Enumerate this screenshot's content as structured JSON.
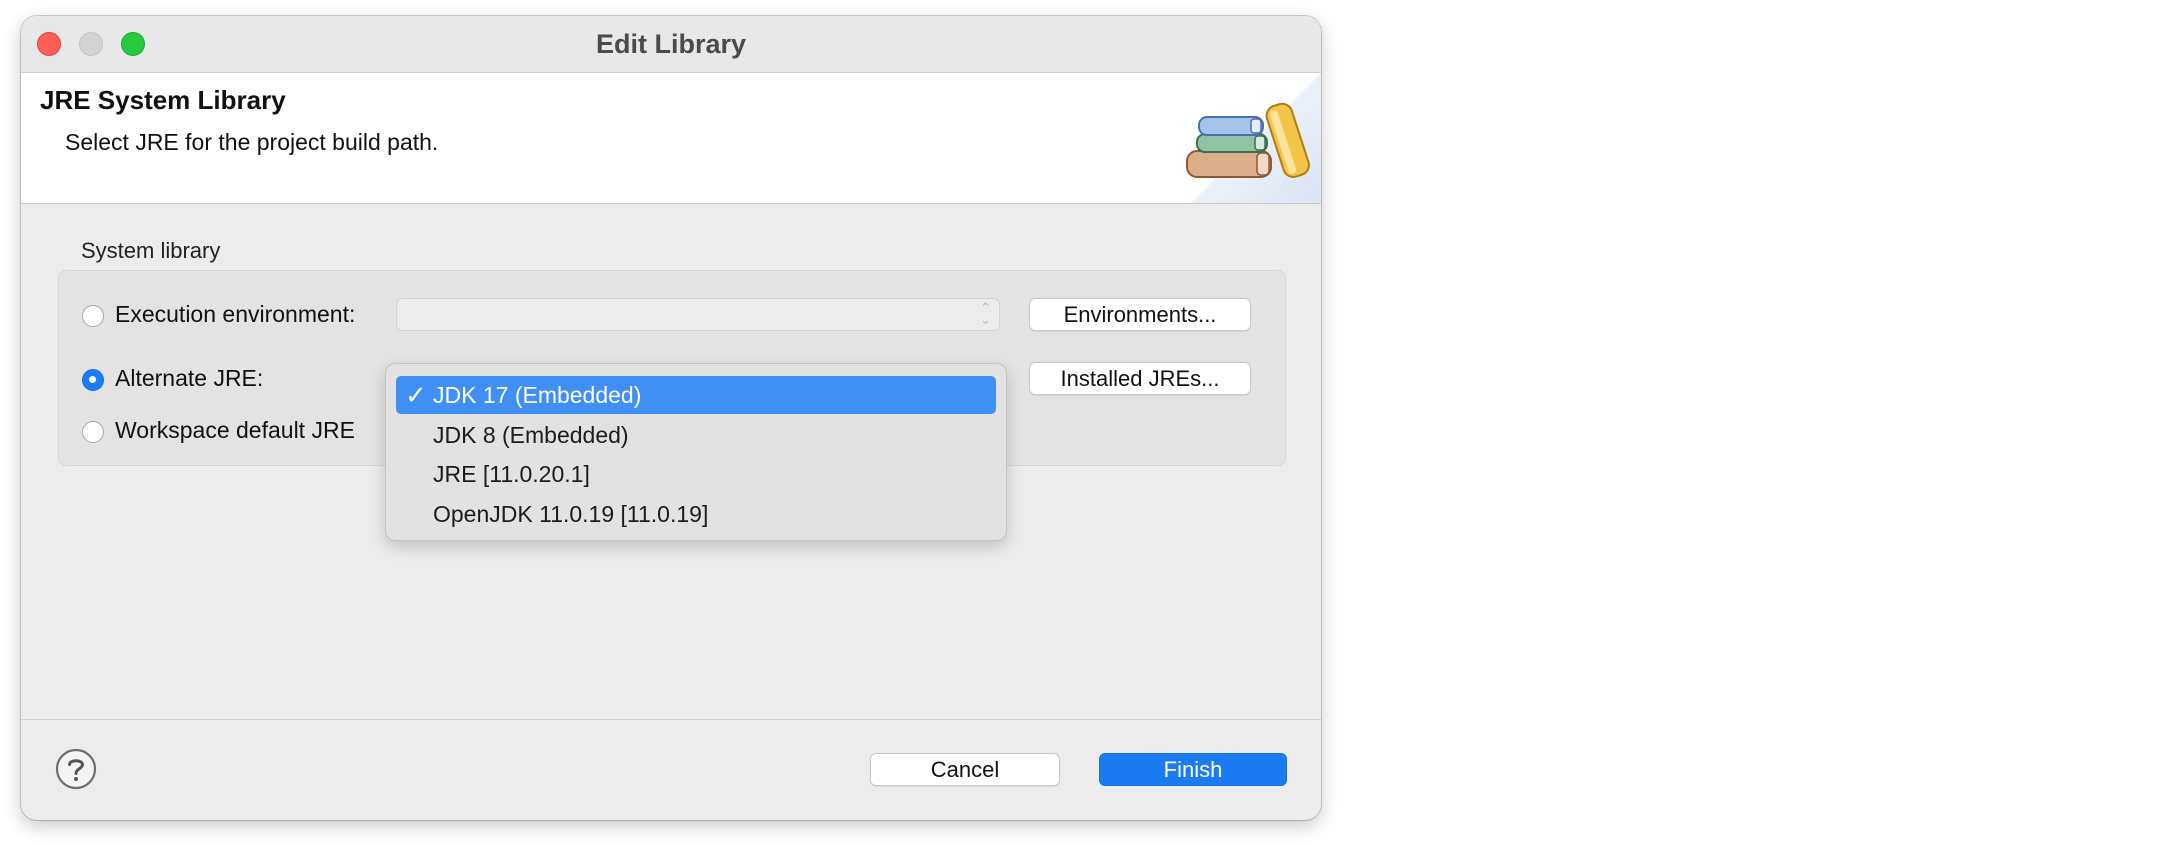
{
  "window": {
    "title": "Edit Library"
  },
  "banner": {
    "title": "JRE System Library",
    "description": "Select JRE for the project build path.",
    "icon": "library-books-icon"
  },
  "system_library": {
    "group_label": "System library",
    "execution_environment": {
      "label": "Execution environment:",
      "selected": false,
      "value": "",
      "button_label": "Environments..."
    },
    "alternate_jre": {
      "label": "Alternate JRE:",
      "selected": true,
      "value": "JDK 17 (Embedded)",
      "button_label": "Installed JREs..."
    },
    "workspace_default": {
      "label": "Workspace default JRE",
      "selected": false
    }
  },
  "jre_dropdown": {
    "open": true,
    "selected_index": 0,
    "options": [
      "JDK 17 (Embedded)",
      "JDK 8 (Embedded)",
      "JRE [11.0.20.1]",
      "OpenJDK 11.0.19 [11.0.19]"
    ]
  },
  "footer": {
    "help_icon": "question-mark-circle-icon",
    "cancel_label": "Cancel",
    "finish_label": "Finish"
  },
  "colors": {
    "accent": "#1a7cf0",
    "selection": "#3f8ff5",
    "close": "#fe5f57",
    "zoom": "#28c840"
  }
}
